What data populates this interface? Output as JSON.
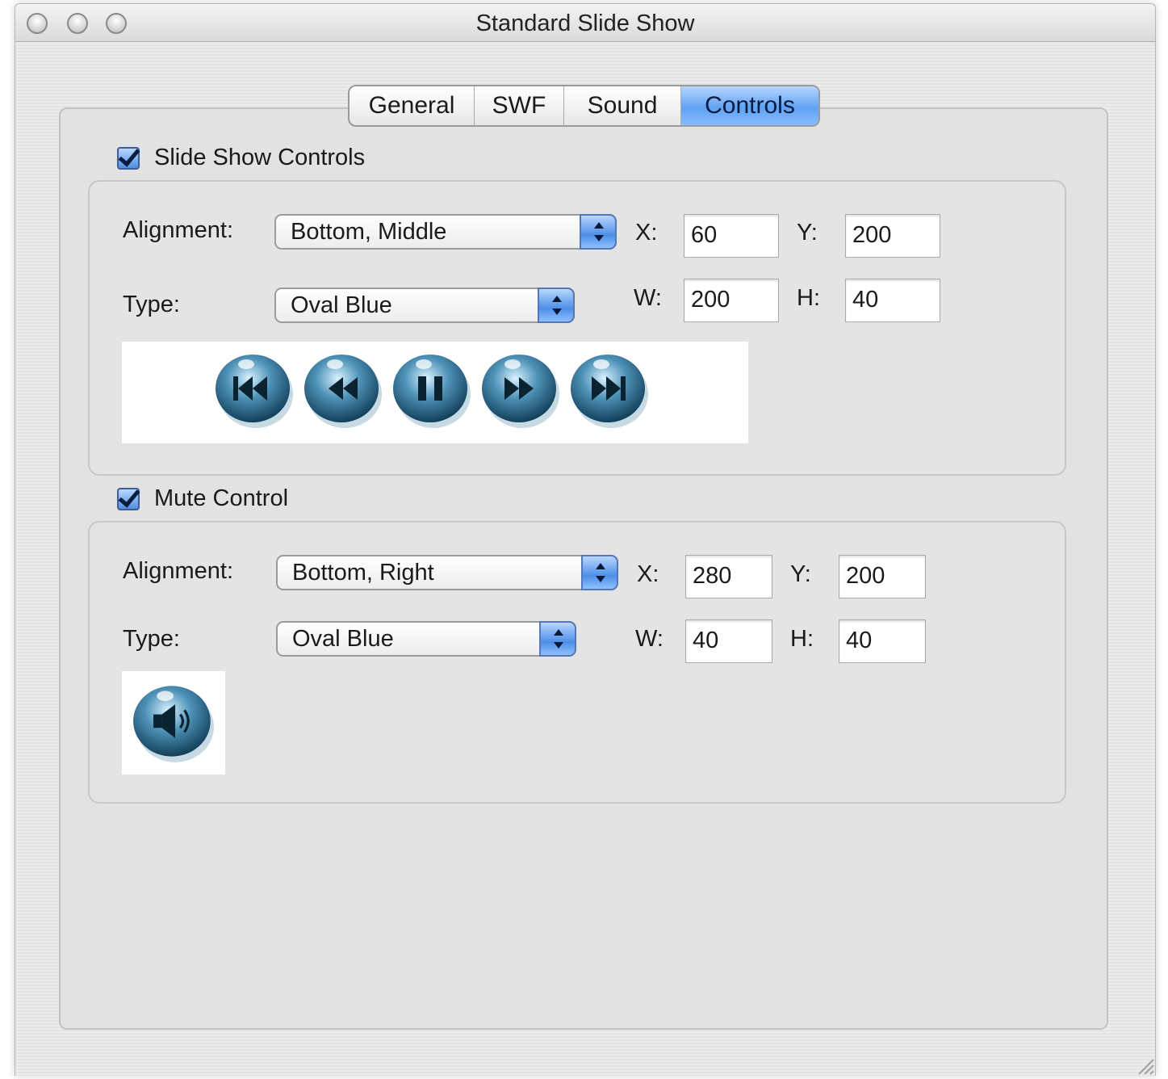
{
  "window": {
    "title": "Standard Slide Show"
  },
  "tabs": [
    {
      "label": "General",
      "active": false
    },
    {
      "label": "SWF",
      "active": false
    },
    {
      "label": "Sound",
      "active": false
    },
    {
      "label": "Controls",
      "active": true
    }
  ],
  "slideshow": {
    "checkbox_label": "Slide Show Controls",
    "checked": true,
    "alignment_label": "Alignment:",
    "alignment_value": "Bottom, Middle",
    "type_label": "Type:",
    "type_value": "Oval Blue",
    "x_label": "X:",
    "x_value": "60",
    "y_label": "Y:",
    "y_value": "200",
    "w_label": "W:",
    "w_value": "200",
    "h_label": "H:",
    "h_value": "40",
    "preview_buttons": [
      "skip-to-start-icon",
      "rewind-icon",
      "pause-icon",
      "fast-forward-icon",
      "skip-to-end-icon"
    ]
  },
  "mute": {
    "checkbox_label": "Mute Control",
    "checked": true,
    "alignment_label": "Alignment:",
    "alignment_value": "Bottom, Right",
    "type_label": "Type:",
    "type_value": "Oval Blue",
    "x_label": "X:",
    "x_value": "280",
    "y_label": "Y:",
    "y_value": "200",
    "w_label": "W:",
    "w_value": "40",
    "h_label": "H:",
    "h_value": "40",
    "preview_buttons": [
      "speaker-icon"
    ]
  },
  "colors": {
    "accent": "#5fa2f2",
    "panel": "#e2e2e2",
    "button_blue": "#2f6f96"
  }
}
